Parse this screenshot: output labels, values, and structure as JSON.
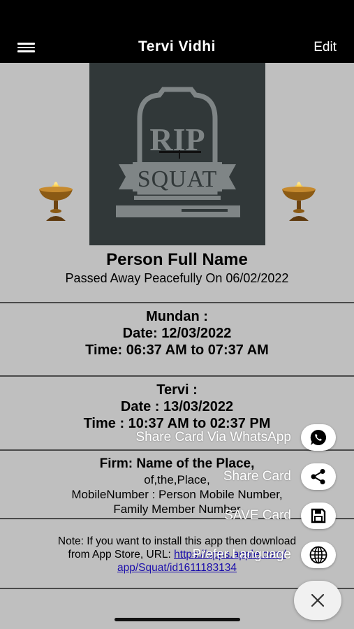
{
  "header": {
    "title": "Tervi Vidhi",
    "edit_label": "Edit"
  },
  "photo": {
    "rip_text": "RIP",
    "banner_text": "SQUAT"
  },
  "person": {
    "name": "Person Full Name",
    "passed_line": "Passed Away Peacefully On 06/02/2022"
  },
  "mundan": {
    "title": "Mundan :",
    "date": "Date: 12/03/2022",
    "time": "Time: 06:37 AM to 07:37 AM"
  },
  "tervi": {
    "title": "Tervi :",
    "date": "Date : 13/03/2022",
    "time": "Time : 10:37 AM to 02:37 PM"
  },
  "firm": {
    "title": "Firm: Name of the Place,",
    "address": "of,the,Place,",
    "mobile": "MobileNumber : Person Mobile Number,",
    "family": "Family Member Number"
  },
  "note": {
    "line1": "Note: If you want to install this app then download",
    "line2_prefix": "from App Store, URL: ",
    "url_part1": "https://apps.apple.com/",
    "url_part2": "app/Squat/id1611183134"
  },
  "fab_menu": {
    "whatsapp_label": "Share Card Via WhatsApp",
    "share_label": "Share Card",
    "save_label": "SAVE Card",
    "language_label": "Prefer Language"
  },
  "colors": {
    "header_bg": "#000000",
    "page_bg": "#bfbfbf",
    "photo_bg": "#313839",
    "link": "#1a0dab"
  }
}
